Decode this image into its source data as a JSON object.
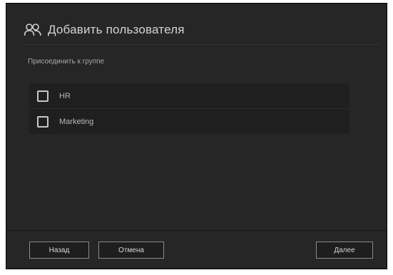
{
  "dialog": {
    "title": "Добавить пользователя",
    "title_icon": "users-icon",
    "section_label": "Присоединить к группе",
    "groups": [
      {
        "name": "HR",
        "checked": false
      },
      {
        "name": "Marketing",
        "checked": false
      }
    ]
  },
  "footer": {
    "back_label": "Назад",
    "cancel_label": "Отмена",
    "next_label": "Далее"
  }
}
